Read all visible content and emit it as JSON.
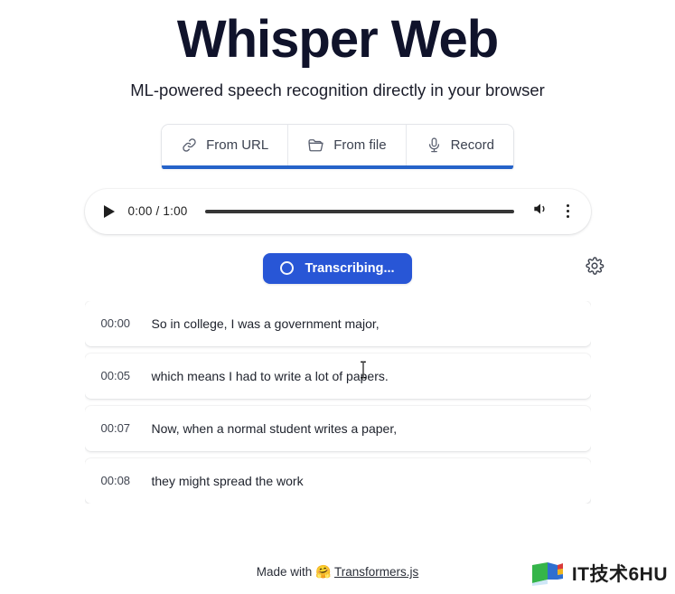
{
  "header": {
    "title": "Whisper Web",
    "subtitle": "ML-powered speech recognition directly in your browser"
  },
  "tabs": [
    {
      "label": "From URL",
      "icon": "link-icon",
      "active": true
    },
    {
      "label": "From file",
      "icon": "folder-icon",
      "active": false
    },
    {
      "label": "Record",
      "icon": "microphone-icon",
      "active": false
    }
  ],
  "player": {
    "play_icon": "play-icon",
    "time": "0:00 / 1:00",
    "current_time": "0:00",
    "duration": "1:00",
    "progress_percent": 0,
    "volume_icon": "volume-icon",
    "menu_icon": "kebab-menu-icon"
  },
  "actions": {
    "transcribe_label": "Transcribing...",
    "transcribe_state": "loading",
    "spinner_icon": "spinner-icon",
    "settings_icon": "gear-icon"
  },
  "transcript": [
    {
      "time": "00:00",
      "text": "So in college, I was a government major,"
    },
    {
      "time": "00:05",
      "text": "which means I had to write a lot of papers."
    },
    {
      "time": "00:07",
      "text": "Now, when a normal student writes a paper,"
    },
    {
      "time": "00:08",
      "text": "they might spread the work"
    }
  ],
  "footer": {
    "made_with": "Made with",
    "emoji": "🤗",
    "link_label": "Transformers.js"
  },
  "watermark": {
    "text": "IT技术6HU",
    "logo_icon": "flag-logo-icon"
  },
  "colors": {
    "accent_blue": "#2856d6",
    "tab_underline": "#2563c9",
    "title": "#10132b",
    "background": "#ffffff"
  }
}
